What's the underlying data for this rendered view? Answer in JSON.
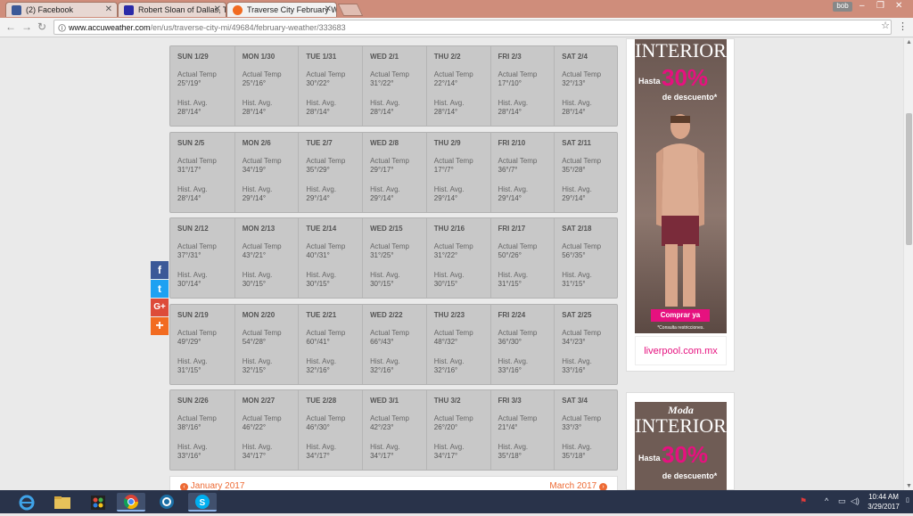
{
  "browser": {
    "tabs": [
      {
        "label": "(2) Facebook",
        "favicon_color": "#3b5998"
      },
      {
        "label": "Robert Sloan of Dallas, T",
        "favicon_color": "#2b2aa8"
      },
      {
        "label": "Traverse City February W",
        "favicon_color": "#f26b21"
      }
    ],
    "user": "bob",
    "url_host": "www.accuweather.com",
    "url_path": "/en/us/traverse-city-mi/49684/february-weather/333683"
  },
  "labels": {
    "actual": "Actual Temp",
    "hist": "Hist. Avg."
  },
  "weeks": [
    [
      {
        "day": "SUN 1/29",
        "actual": "25°/19°",
        "hist": "28°/14°"
      },
      {
        "day": "MON 1/30",
        "actual": "25°/16°",
        "hist": "28°/14°"
      },
      {
        "day": "TUE 1/31",
        "actual": "30°/22°",
        "hist": "28°/14°"
      },
      {
        "day": "WED 2/1",
        "actual": "31°/22°",
        "hist": "28°/14°"
      },
      {
        "day": "THU 2/2",
        "actual": "22°/14°",
        "hist": "28°/14°"
      },
      {
        "day": "FRI 2/3",
        "actual": "17°/10°",
        "hist": "28°/14°"
      },
      {
        "day": "SAT 2/4",
        "actual": "32°/13°",
        "hist": "28°/14°"
      }
    ],
    [
      {
        "day": "SUN 2/5",
        "actual": "31°/17°",
        "hist": "28°/14°"
      },
      {
        "day": "MON 2/6",
        "actual": "34°/19°",
        "hist": "29°/14°"
      },
      {
        "day": "TUE 2/7",
        "actual": "35°/29°",
        "hist": "29°/14°"
      },
      {
        "day": "WED 2/8",
        "actual": "29°/17°",
        "hist": "29°/14°"
      },
      {
        "day": "THU 2/9",
        "actual": "17°/7°",
        "hist": "29°/14°"
      },
      {
        "day": "FRI 2/10",
        "actual": "36°/7°",
        "hist": "29°/14°"
      },
      {
        "day": "SAT 2/11",
        "actual": "35°/28°",
        "hist": "29°/14°"
      }
    ],
    [
      {
        "day": "SUN 2/12",
        "actual": "37°/31°",
        "hist": "30°/14°"
      },
      {
        "day": "MON 2/13",
        "actual": "43°/21°",
        "hist": "30°/15°"
      },
      {
        "day": "TUE 2/14",
        "actual": "40°/31°",
        "hist": "30°/15°"
      },
      {
        "day": "WED 2/15",
        "actual": "31°/25°",
        "hist": "30°/15°"
      },
      {
        "day": "THU 2/16",
        "actual": "31°/22°",
        "hist": "30°/15°"
      },
      {
        "day": "FRI 2/17",
        "actual": "50°/26°",
        "hist": "31°/15°"
      },
      {
        "day": "SAT 2/18",
        "actual": "56°/35°",
        "hist": "31°/15°"
      }
    ],
    [
      {
        "day": "SUN 2/19",
        "actual": "49°/29°",
        "hist": "31°/15°"
      },
      {
        "day": "MON 2/20",
        "actual": "54°/28°",
        "hist": "32°/15°"
      },
      {
        "day": "TUE 2/21",
        "actual": "60°/41°",
        "hist": "32°/16°"
      },
      {
        "day": "WED 2/22",
        "actual": "66°/43°",
        "hist": "32°/16°"
      },
      {
        "day": "THU 2/23",
        "actual": "48°/32°",
        "hist": "32°/16°"
      },
      {
        "day": "FRI 2/24",
        "actual": "36°/30°",
        "hist": "33°/16°"
      },
      {
        "day": "SAT 2/25",
        "actual": "34°/23°",
        "hist": "33°/16°"
      }
    ],
    [
      {
        "day": "SUN 2/26",
        "actual": "38°/16°",
        "hist": "33°/16°"
      },
      {
        "day": "MON 2/27",
        "actual": "46°/22°",
        "hist": "34°/17°"
      },
      {
        "day": "TUE 2/28",
        "actual": "46°/30°",
        "hist": "34°/17°"
      },
      {
        "day": "WED 3/1",
        "actual": "42°/23°",
        "hist": "34°/17°"
      },
      {
        "day": "THU 3/2",
        "actual": "26°/20°",
        "hist": "34°/17°"
      },
      {
        "day": "FRI 3/3",
        "actual": "21°/4°",
        "hist": "35°/18°"
      },
      {
        "day": "SAT 3/4",
        "actual": "33°/3°",
        "hist": "35°/18°"
      }
    ]
  ],
  "month_nav": {
    "prev": "January 2017",
    "next": "March 2017"
  },
  "ad": {
    "moda": "Moda",
    "brand": "INTERIOR",
    "hasta": "Hasta",
    "percent": "30%",
    "descuento": "de descuento*",
    "cta": "Comprar ya",
    "fine": "*Consulta restricciones.",
    "logo": "liverpool.com.mx"
  },
  "share": [
    {
      "icon": "facebook-icon",
      "glyph": "f",
      "color": "#3b5998"
    },
    {
      "icon": "twitter-icon",
      "glyph": "t",
      "color": "#1da1f2"
    },
    {
      "icon": "google-plus-icon",
      "glyph": "G+",
      "color": "#dd4b39"
    },
    {
      "icon": "more-share-icon",
      "glyph": "+",
      "color": "#f26b21"
    }
  ],
  "clock": {
    "time": "10:44 AM",
    "date": "3/29/2017"
  }
}
